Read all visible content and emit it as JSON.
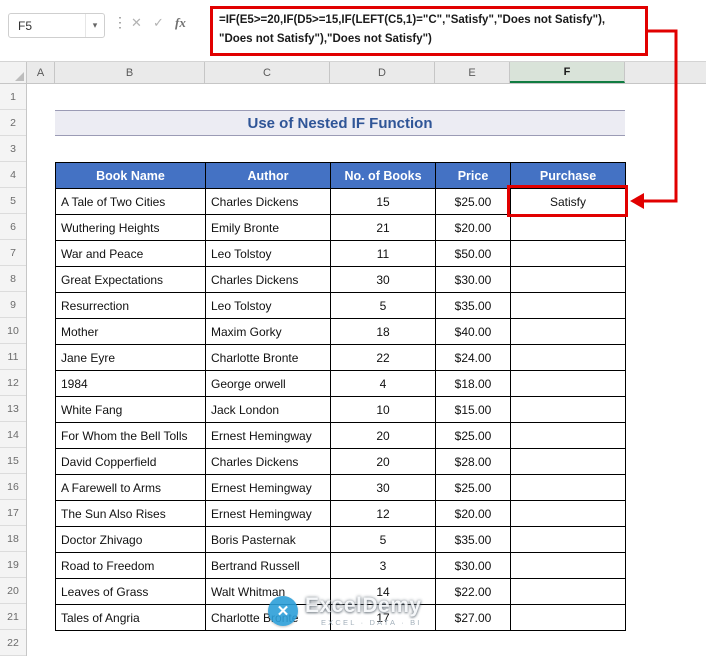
{
  "formula_bar": {
    "name_box": "F5",
    "chevron_icon": "▾",
    "more_icon": "⋮",
    "cancel_icon": "✕",
    "confirm_icon": "✓",
    "fx_icon": "fx",
    "line1": "=IF(E5>=20,IF(D5>=15,IF(LEFT(C5,1)=\"C\",\"Satisfy\",\"Does not Satisfy\"),",
    "line2": "\"Does not Satisfy\"),\"Does not Satisfy\")"
  },
  "sheet": {
    "title": "Use of Nested IF Function",
    "column_headers": [
      "A",
      "B",
      "C",
      "D",
      "E",
      "F"
    ],
    "selected_column": "F",
    "selected_cell": "F5",
    "row_headers": [
      "1",
      "2",
      "3",
      "4",
      "5",
      "6",
      "7",
      "8",
      "9",
      "10",
      "11",
      "12",
      "13",
      "14",
      "15",
      "16",
      "17",
      "18",
      "19",
      "20",
      "21",
      "22"
    ]
  },
  "table": {
    "headers": [
      "Book Name",
      "Author",
      "No. of Books",
      "Price",
      "Purchase"
    ],
    "rows": [
      [
        "A Tale of Two Cities",
        "Charles Dickens",
        "15",
        "$25.00",
        "Satisfy"
      ],
      [
        "Wuthering Heights",
        "Emily Bronte",
        "21",
        "$20.00",
        ""
      ],
      [
        "War and Peace",
        "Leo Tolstoy",
        "11",
        "$50.00",
        ""
      ],
      [
        "Great Expectations",
        "Charles Dickens",
        "30",
        "$30.00",
        ""
      ],
      [
        "Resurrection",
        "Leo Tolstoy",
        "5",
        "$35.00",
        ""
      ],
      [
        "Mother",
        "Maxim Gorky",
        "18",
        "$40.00",
        ""
      ],
      [
        "Jane Eyre",
        "Charlotte Bronte",
        "22",
        "$24.00",
        ""
      ],
      [
        "1984",
        "George orwell",
        "4",
        "$18.00",
        ""
      ],
      [
        "White Fang",
        "Jack London",
        "10",
        "$15.00",
        ""
      ],
      [
        "For Whom the Bell Tolls",
        "Ernest Hemingway",
        "20",
        "$25.00",
        ""
      ],
      [
        "David Copperfield",
        "Charles Dickens",
        "20",
        "$28.00",
        ""
      ],
      [
        "A Farewell to Arms",
        "Ernest Hemingway",
        "30",
        "$25.00",
        ""
      ],
      [
        "The Sun Also Rises",
        "Ernest Hemingway",
        "12",
        "$20.00",
        ""
      ],
      [
        "Doctor Zhivago",
        "Boris Pasternak",
        "5",
        "$35.00",
        ""
      ],
      [
        "Road to Freedom",
        "Bertrand Russell",
        "3",
        "$30.00",
        ""
      ],
      [
        "Leaves of Grass",
        "Walt Whitman",
        "14",
        "$22.00",
        ""
      ],
      [
        "Tales of Angria",
        "Charlotte Bronte",
        "17",
        "$27.00",
        ""
      ]
    ]
  },
  "watermark": {
    "logo_icon": "✕",
    "brand": "ExcelDemy",
    "tagline": "EXCEL · DATA · BI"
  },
  "colors": {
    "header_blue": "#4472C4",
    "title_blue": "#2F5597",
    "annotation_red": "#E10000",
    "selection_green": "#107C41"
  }
}
